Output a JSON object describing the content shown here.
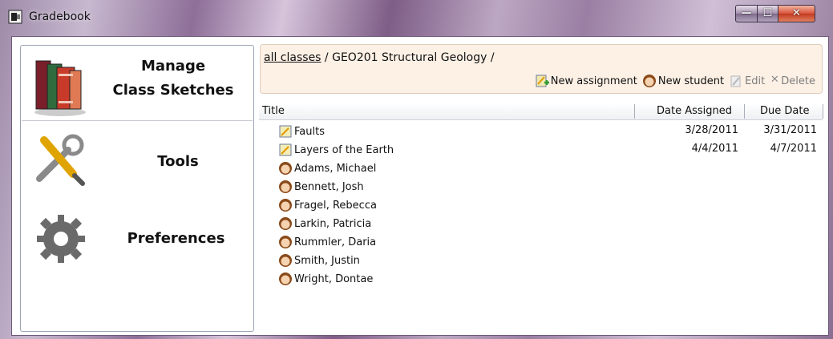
{
  "window": {
    "title": "Gradebook"
  },
  "caption_buttons": {
    "minimize": "—",
    "maximize": "☐",
    "close": "✕"
  },
  "sidebar": {
    "items": [
      {
        "label_line1": "Manage",
        "label_line2": "Class Sketches",
        "icon": "books-icon",
        "active": true
      },
      {
        "label": "Tools",
        "icon": "tools-icon"
      },
      {
        "label": "Preferences",
        "icon": "gear-icon"
      }
    ]
  },
  "breadcrumb": {
    "root_link": "all classes",
    "separator": " / ",
    "current": "GEO201 Structural Geology /"
  },
  "toolbar": {
    "new_assignment": "New assignment",
    "new_student": "New student",
    "edit": "Edit",
    "delete": "Delete"
  },
  "table": {
    "columns": [
      "Title",
      "Date Assigned",
      "Due Date"
    ],
    "rows": [
      {
        "type": "assignment",
        "title": "Faults",
        "date_assigned": "3/28/2011",
        "due_date": "3/31/2011"
      },
      {
        "type": "assignment",
        "title": "Layers of the Earth",
        "date_assigned": "4/4/2011",
        "due_date": "4/7/2011"
      },
      {
        "type": "student",
        "title": "Adams, Michael",
        "date_assigned": "",
        "due_date": ""
      },
      {
        "type": "student",
        "title": "Bennett, Josh",
        "date_assigned": "",
        "due_date": ""
      },
      {
        "type": "student",
        "title": "Fragel, Rebecca",
        "date_assigned": "",
        "due_date": ""
      },
      {
        "type": "student",
        "title": "Larkin, Patricia",
        "date_assigned": "",
        "due_date": ""
      },
      {
        "type": "student",
        "title": "Rummler, Daria",
        "date_assigned": "",
        "due_date": ""
      },
      {
        "type": "student",
        "title": "Smith, Justin",
        "date_assigned": "",
        "due_date": ""
      },
      {
        "type": "student",
        "title": "Wright, Dontae",
        "date_assigned": "",
        "due_date": ""
      }
    ]
  },
  "colors": {
    "crumb_bg": "#fdf1e6",
    "titlebar_accent": "#8e6f98",
    "close_red": "#c23a22"
  }
}
